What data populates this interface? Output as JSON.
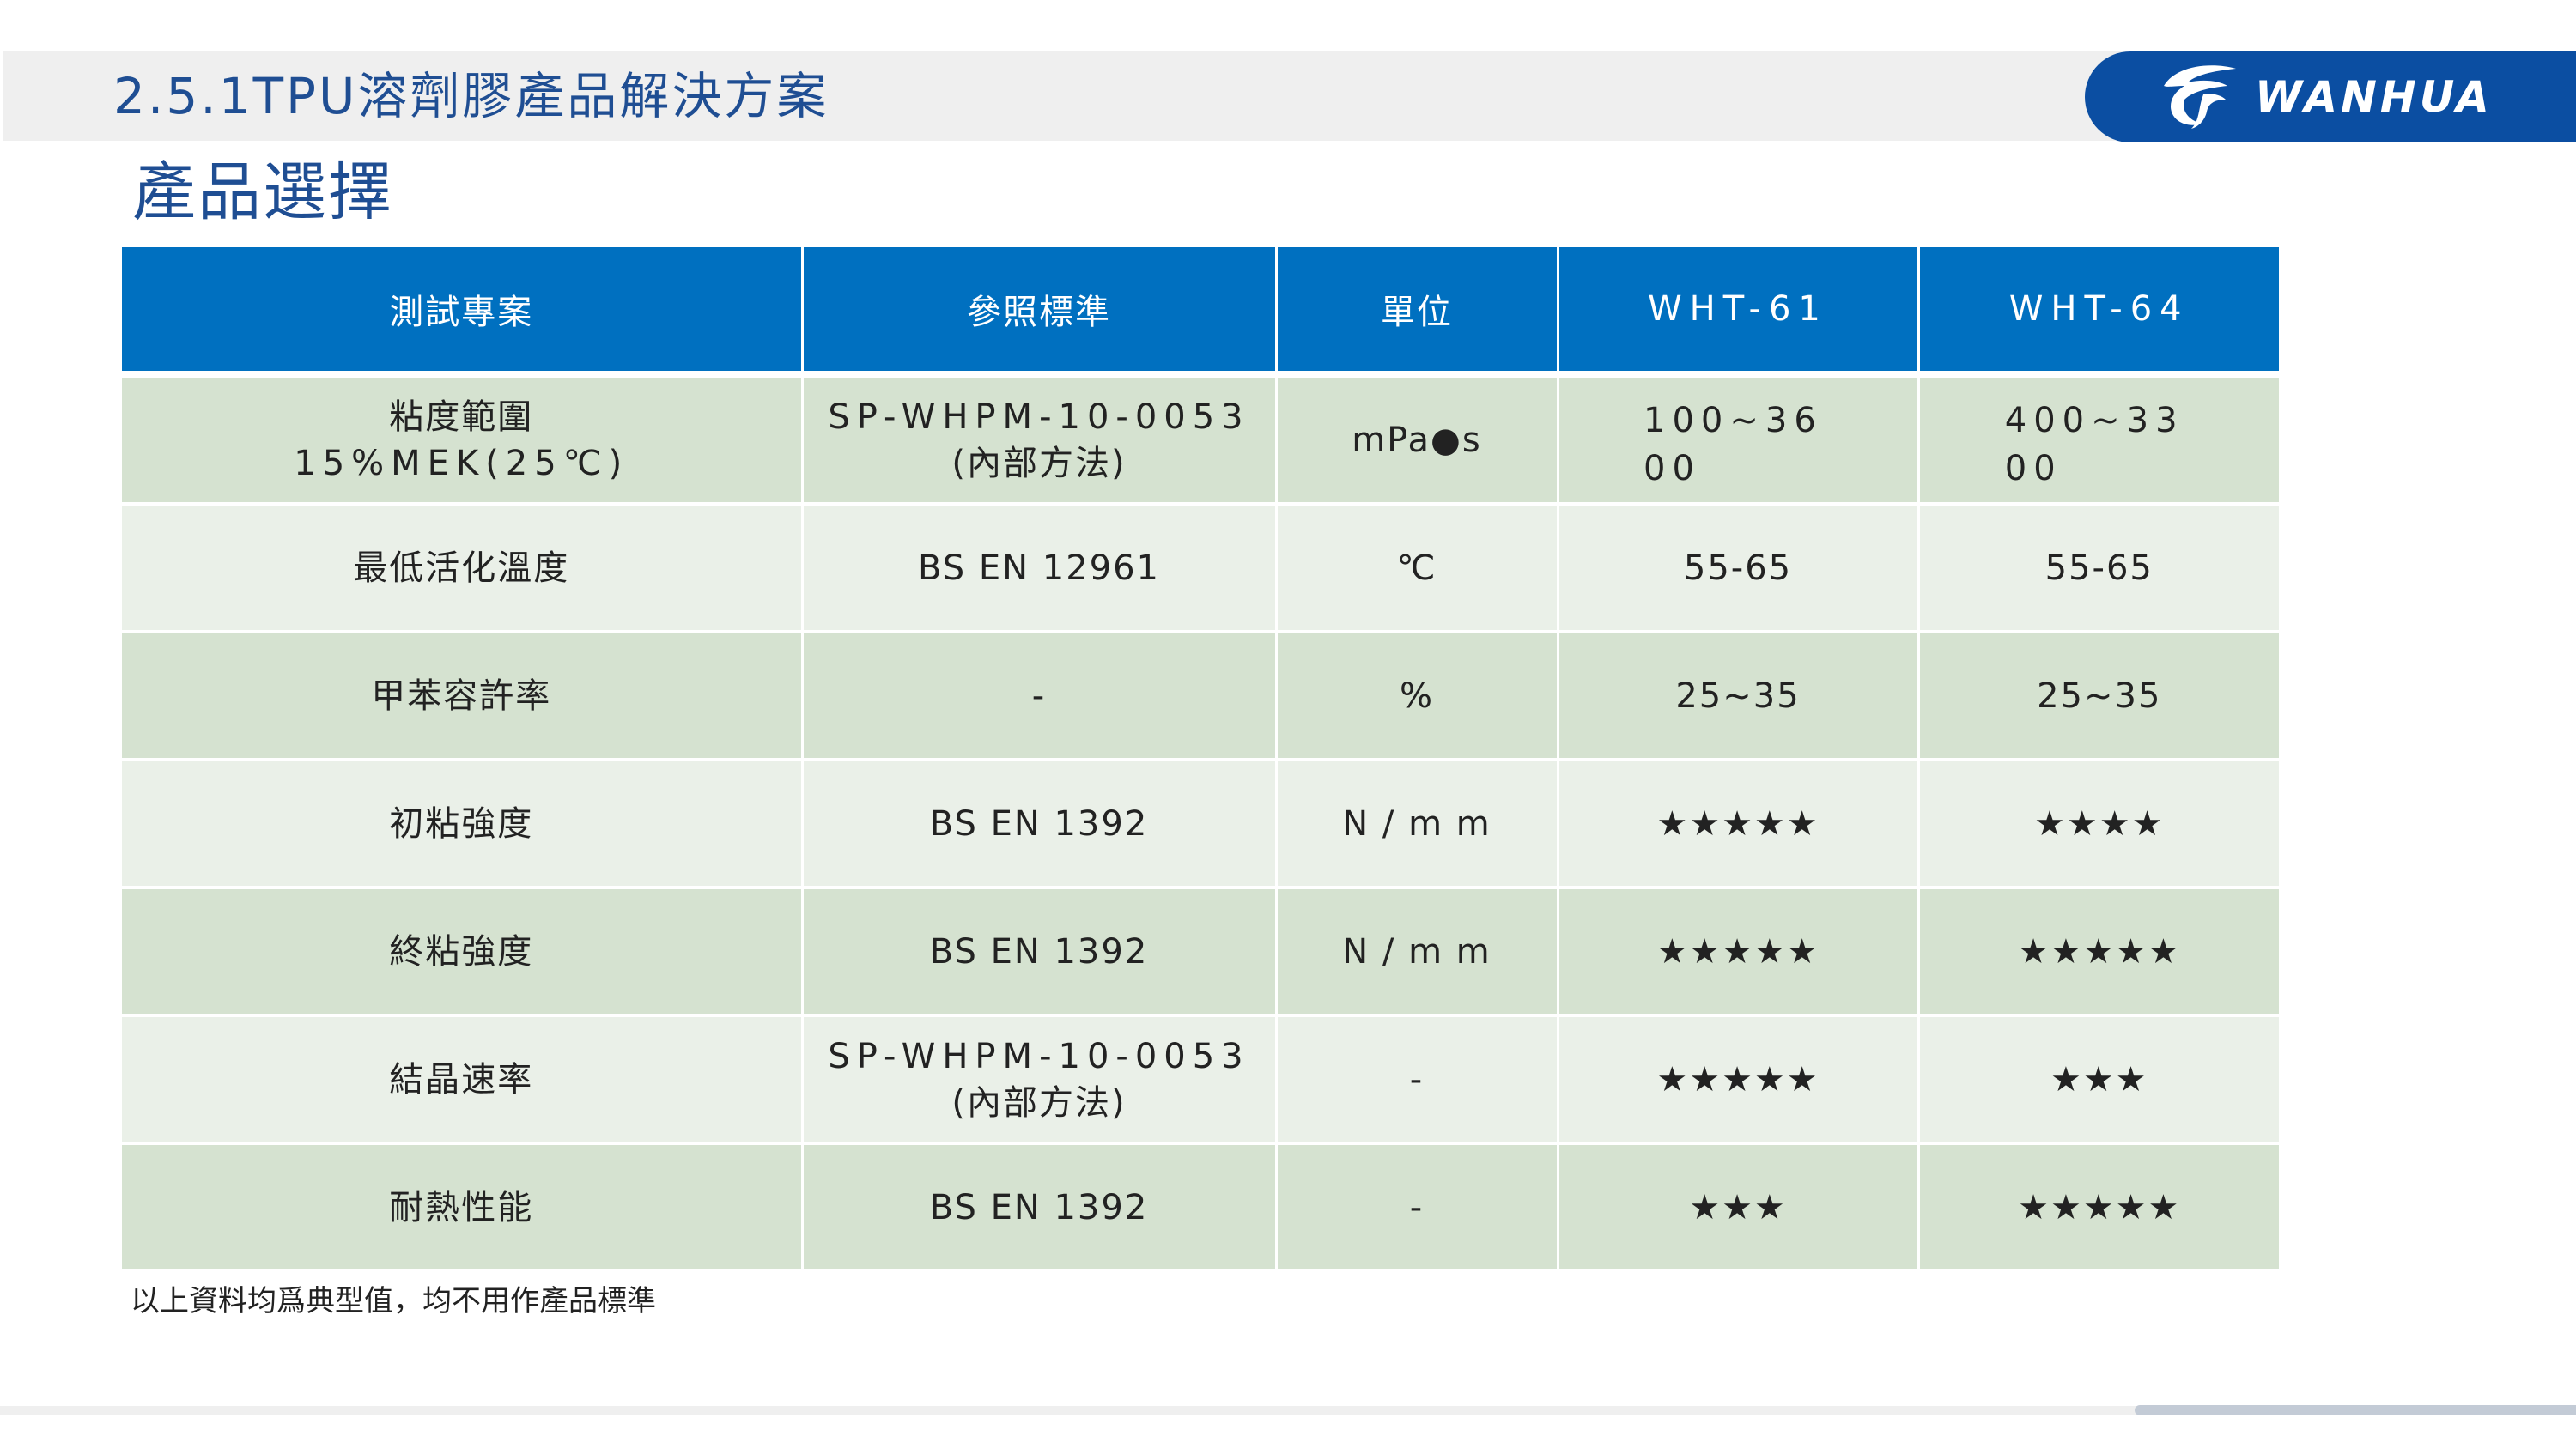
{
  "header": {
    "section_title": "2.5.1TPU溶劑膠產品解決方案",
    "logo_text": "WANHUA",
    "logo_icon": "wanhua-logo-icon",
    "brand_color": "#0b4ea2"
  },
  "page_heading": "產品選擇",
  "table": {
    "header_color": "#0070c0",
    "columns": [
      "測試專案",
      "參照標準",
      "單位",
      "WHT-61",
      "WHT-64"
    ],
    "rows": [
      {
        "item_line1": "粘度範圍",
        "item_line2": "15%MEK(25℃)",
        "std_line1": "SP-WHPM-10-0053",
        "std_line2": "(內部方法)",
        "unit": "mPa●s",
        "wht61": "100~3600",
        "wht64": "400~3300"
      },
      {
        "item_line1": "最低活化溫度",
        "std_line1": "BS EN 12961",
        "unit": "℃",
        "wht61": "55-65",
        "wht64": "55-65"
      },
      {
        "item_line1": "甲苯容許率",
        "std_line1": "-",
        "unit": "%",
        "wht61": "25~35",
        "wht64": "25~35"
      },
      {
        "item_line1": "初粘強度",
        "std_line1": "BS EN 1392",
        "unit": "N / m m",
        "wht61": "★★★★★",
        "wht64": "★★★★"
      },
      {
        "item_line1": "終粘強度",
        "std_line1": "BS EN 1392",
        "unit": "N / m m",
        "wht61": "★★★★★",
        "wht64": "★★★★★"
      },
      {
        "item_line1": "結晶速率",
        "std_line1": "SP-WHPM-10-0053",
        "std_line2": "(內部方法)",
        "unit": "-",
        "wht61": "★★★★★",
        "wht64": "★★★"
      },
      {
        "item_line1": "耐熱性能",
        "std_line1": "BS EN 1392",
        "unit": "-",
        "wht61": "★★★",
        "wht64": "★★★★★"
      }
    ]
  },
  "footnote": "以上資料均爲典型值，均不用作產品標準"
}
